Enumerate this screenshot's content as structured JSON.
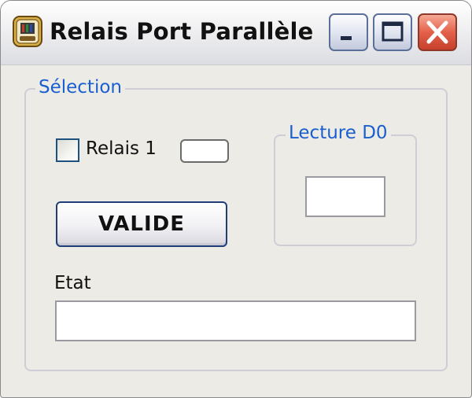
{
  "window": {
    "title": "Relais Port Parallèle",
    "icon": "parallel-port-app-icon",
    "controls": {
      "minimize_icon": "minimize-icon",
      "maximize_icon": "maximize-icon",
      "close_icon": "close-icon"
    }
  },
  "selection_group": {
    "legend": "Sélection",
    "relay_checkbox": {
      "label": "Relais 1",
      "checked": false
    },
    "relay_indicator_value": "",
    "valide_button": "VALIDE",
    "lecture_group": {
      "legend": "Lecture D0",
      "value": ""
    },
    "etat": {
      "label": "Etat",
      "value": ""
    }
  },
  "colors": {
    "legend_text": "#1a5fd0",
    "window_background": "#ecebe6",
    "close_button": "#e3614a",
    "frame_border": "#5b6f98"
  }
}
